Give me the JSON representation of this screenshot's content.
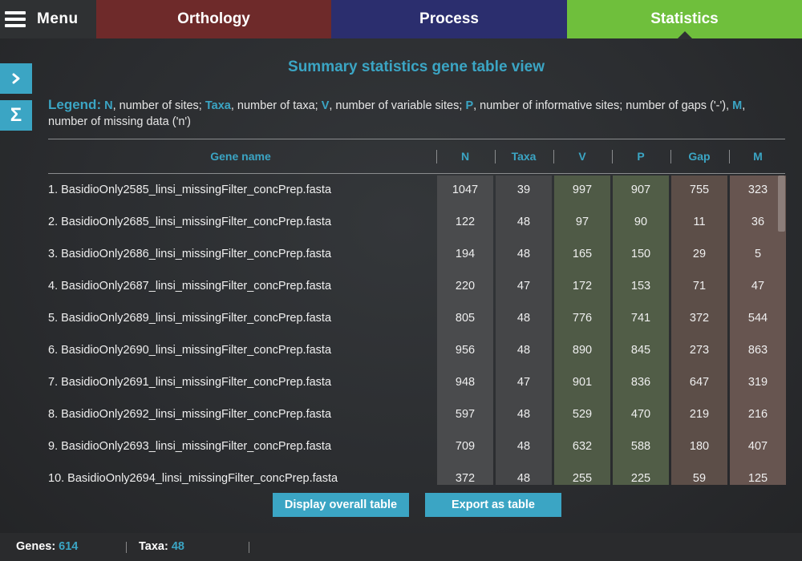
{
  "nav": {
    "menu_label": "Menu",
    "tabs": [
      {
        "label": "Orthology",
        "color": "#6e2a2a"
      },
      {
        "label": "Process",
        "color": "#2b2e6e"
      },
      {
        "label": "Statistics",
        "color": "#6fbf3c"
      }
    ],
    "active_tab": "Statistics"
  },
  "side": {
    "expand_icon": "chevron-right-icon",
    "sum_icon": "sigma-icon",
    "sum_symbol": "Σ"
  },
  "title": "Summary statistics gene table view",
  "legend": {
    "title": "Legend:",
    "items": [
      {
        "key": "N",
        "text": ", number of sites; "
      },
      {
        "key": "Taxa",
        "text": ", number of taxa; "
      },
      {
        "key": "V",
        "text": ", number of variable sites; "
      },
      {
        "key": "P",
        "text": ", number of informative sites;  number of gaps ('-'), "
      },
      {
        "key": "M",
        "text": ", number of missing data ('n')"
      }
    ]
  },
  "table": {
    "headers": [
      "Gene name",
      "N",
      "Taxa",
      "V",
      "P",
      "Gap",
      "M"
    ],
    "rows": [
      {
        "name": "1. BasidioOnly2585_linsi_missingFilter_concPrep.fasta",
        "N": "1047",
        "Taxa": "39",
        "V": "997",
        "P": "907",
        "Gap": "755",
        "M": "323"
      },
      {
        "name": "2. BasidioOnly2685_linsi_missingFilter_concPrep.fasta",
        "N": "122",
        "Taxa": "48",
        "V": "97",
        "P": "90",
        "Gap": "11",
        "M": "36"
      },
      {
        "name": "3. BasidioOnly2686_linsi_missingFilter_concPrep.fasta",
        "N": "194",
        "Taxa": "48",
        "V": "165",
        "P": "150",
        "Gap": "29",
        "M": "5"
      },
      {
        "name": "4. BasidioOnly2687_linsi_missingFilter_concPrep.fasta",
        "N": "220",
        "Taxa": "47",
        "V": "172",
        "P": "153",
        "Gap": "71",
        "M": "47"
      },
      {
        "name": "5. BasidioOnly2689_linsi_missingFilter_concPrep.fasta",
        "N": "805",
        "Taxa": "48",
        "V": "776",
        "P": "741",
        "Gap": "372",
        "M": "544"
      },
      {
        "name": "6. BasidioOnly2690_linsi_missingFilter_concPrep.fasta",
        "N": "956",
        "Taxa": "48",
        "V": "890",
        "P": "845",
        "Gap": "273",
        "M": "863"
      },
      {
        "name": "7. BasidioOnly2691_linsi_missingFilter_concPrep.fasta",
        "N": "948",
        "Taxa": "47",
        "V": "901",
        "P": "836",
        "Gap": "647",
        "M": "319"
      },
      {
        "name": "8. BasidioOnly2692_linsi_missingFilter_concPrep.fasta",
        "N": "597",
        "Taxa": "48",
        "V": "529",
        "P": "470",
        "Gap": "219",
        "M": "216"
      },
      {
        "name": "9. BasidioOnly2693_linsi_missingFilter_concPrep.fasta",
        "N": "709",
        "Taxa": "48",
        "V": "632",
        "P": "588",
        "Gap": "180",
        "M": "407"
      },
      {
        "name": "10. BasidioOnly2694_linsi_missingFilter_concPrep.fasta",
        "N": "372",
        "Taxa": "48",
        "V": "255",
        "P": "225",
        "Gap": "59",
        "M": "125"
      }
    ]
  },
  "buttons": {
    "overall": "Display overall table",
    "export": "Export as table"
  },
  "footer": {
    "genes_label": "Genes:",
    "genes_value": "614",
    "taxa_label": "Taxa:",
    "taxa_value": "48"
  },
  "colors": {
    "accent": "#3ba5c4"
  }
}
